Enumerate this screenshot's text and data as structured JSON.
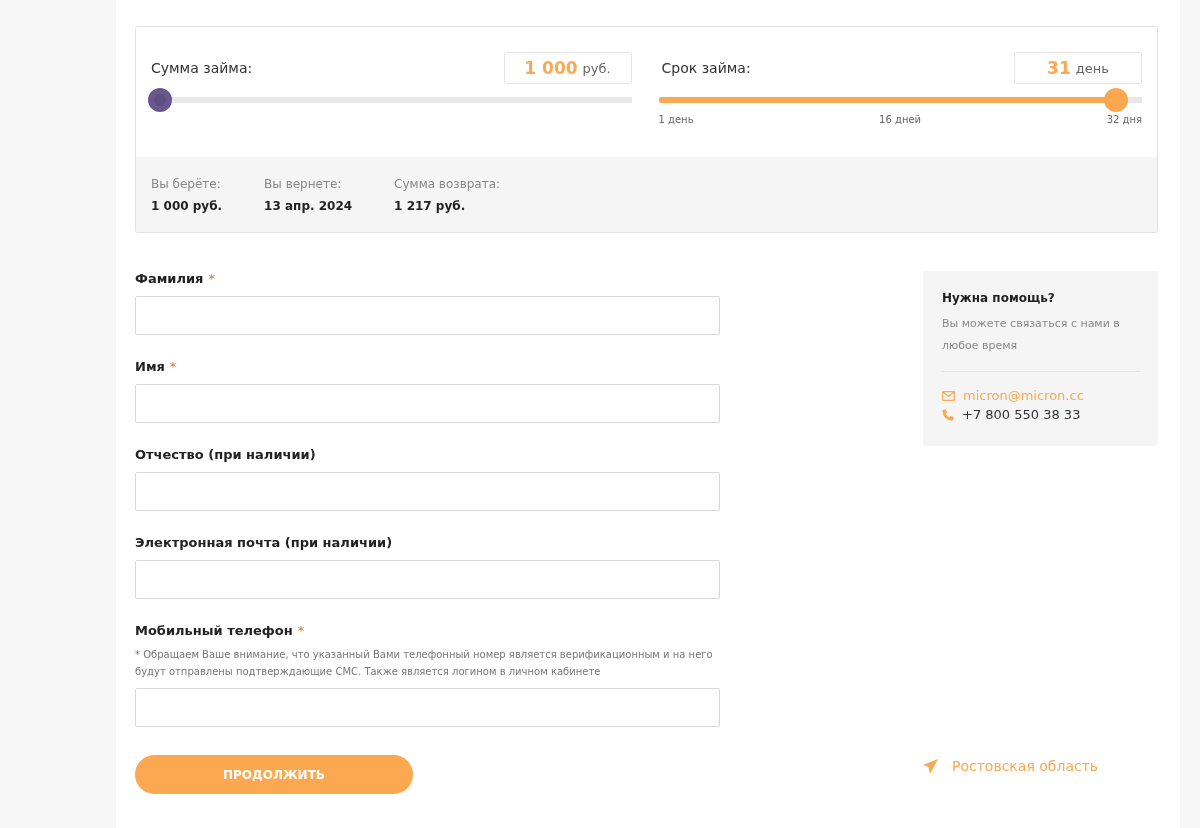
{
  "calculator": {
    "sliders": [
      {
        "label": "Сумма займа:",
        "value": "1 000",
        "unit": "руб.",
        "level": 0,
        "active": false
      },
      {
        "label": "Срок займа:",
        "value": "31",
        "unit": "день",
        "level": 0.97,
        "active": true,
        "ticks": [
          "1 день",
          "16 дней",
          "32 дня"
        ]
      }
    ],
    "summary": [
      {
        "label": "Вы берёте:",
        "value": "1 000 руб."
      },
      {
        "label": "Вы вернете:",
        "value": "13 апр. 2024"
      },
      {
        "label": "Сумма возврата:",
        "value": "1 217 руб."
      }
    ]
  },
  "form": {
    "fields": [
      {
        "label": "Фамилия",
        "required": true
      },
      {
        "label": "Имя",
        "required": true
      },
      {
        "label": "Отчество (при наличии)"
      },
      {
        "label": "Электронная почта (при наличии)"
      },
      {
        "label": "Мобильный телефон",
        "required": true,
        "note": "* Обращаем Ваше внимание, что указанный Вами телефонный номер является верификационным и на него будут отправлены подтверждающие СМС. Также является логином в личном кабинете"
      }
    ],
    "required_mark": "*",
    "submit": "ПРОДОЛЖИТЬ"
  },
  "help": {
    "title": "Нужна помощь?",
    "text": "Вы можете связаться с нами в любое время",
    "email": "micron@micron.cc",
    "phone": "+7 800 550 38 33"
  },
  "region": "Ростовская область"
}
